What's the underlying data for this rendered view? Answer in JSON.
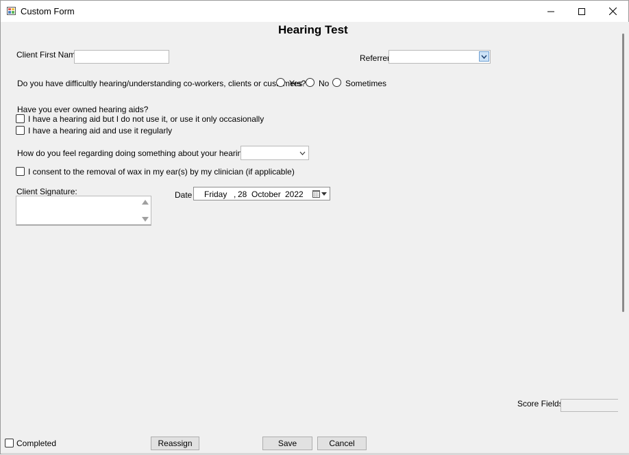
{
  "window": {
    "title": "Custom Form",
    "controls": [
      "minimize-icon",
      "maximize-icon",
      "close-icon"
    ]
  },
  "form": {
    "heading": "Hearing Test",
    "client_first_name_label": "Client First Name",
    "client_first_name_value": "",
    "referrer_label": "Referrer",
    "referrer_value": "",
    "difficulty_question": "Do you have difficultly hearing/understanding co-workers, clients or customers?",
    "difficulty_options": [
      "Yes",
      "No",
      "Sometimes"
    ],
    "hearing_aids_question": "Have you ever owned hearing aids?",
    "hearing_aid_option_1": "I have a hearing aid but I do not use it, or use it only occasionally",
    "hearing_aid_option_2": "I have a hearing aid and use it regularly",
    "feel_question": "How do you feel regarding doing something about your hearing loss?",
    "feel_value": "",
    "consent_label": "I consent to the removal of wax in my ear(s) by my clinician (if applicable)",
    "signature_label": "Client Signature:",
    "date_label": "Date",
    "date": {
      "weekday": "Friday",
      "sep": ",",
      "day": "28",
      "month": "October",
      "year": "2022"
    },
    "score_fields_label": "Score Fields"
  },
  "footer": {
    "completed_label": "Completed",
    "reassign_label": "Reassign",
    "save_label": "Save",
    "cancel_label": "Cancel"
  }
}
